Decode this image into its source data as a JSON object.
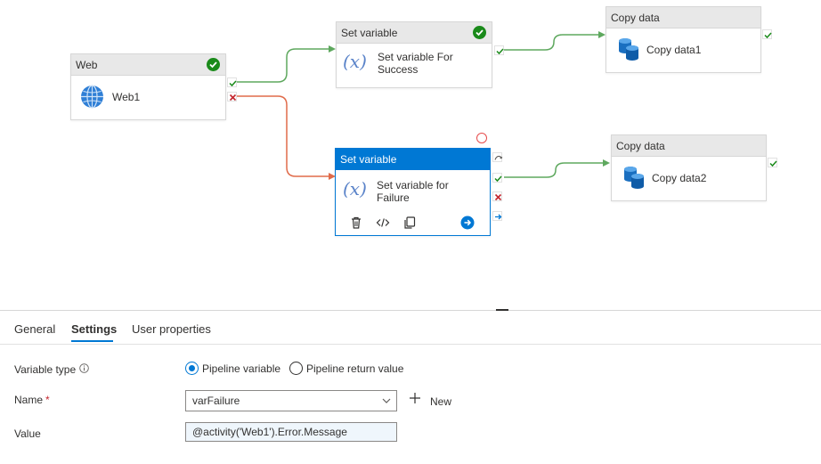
{
  "pipeline": {
    "web": {
      "type": "Web",
      "name": "Web1"
    },
    "set_success": {
      "type": "Set variable",
      "name_line1": "Set variable For",
      "name_line2": "Success"
    },
    "set_failure": {
      "type": "Set variable",
      "name_line1": "Set variable for",
      "name_line2": "Failure"
    },
    "copy1": {
      "type": "Copy data",
      "name": "Copy data1"
    },
    "copy2": {
      "type": "Copy data",
      "name": "Copy data2"
    },
    "var_icon": "(x)"
  },
  "colors": {
    "accent": "#0078d4",
    "success": "#1a8a1a",
    "success_edge": "#5ea85e",
    "failure": "#e06b4a",
    "failure_port": "#c4262e",
    "header_bg": "#e8e8e8"
  },
  "icons": {
    "web": "globe-icon",
    "copy": "database-icon",
    "delete": "trash-icon",
    "code": "code-icon",
    "clone": "copy-icon",
    "go": "arrow-right-icon"
  },
  "tabs": [
    {
      "label": "General",
      "active": false
    },
    {
      "label": "Settings",
      "active": true
    },
    {
      "label": "User properties",
      "active": false
    }
  ],
  "settings": {
    "variable_type_label": "Variable type",
    "options": [
      "Pipeline variable",
      "Pipeline return value"
    ],
    "selected_option": "Pipeline variable",
    "name_label": "Name",
    "required_mark": "*",
    "name_value": "varFailure",
    "new_label": "New",
    "value_label": "Value",
    "value_text": "@activity('Web1').Error.Message"
  }
}
